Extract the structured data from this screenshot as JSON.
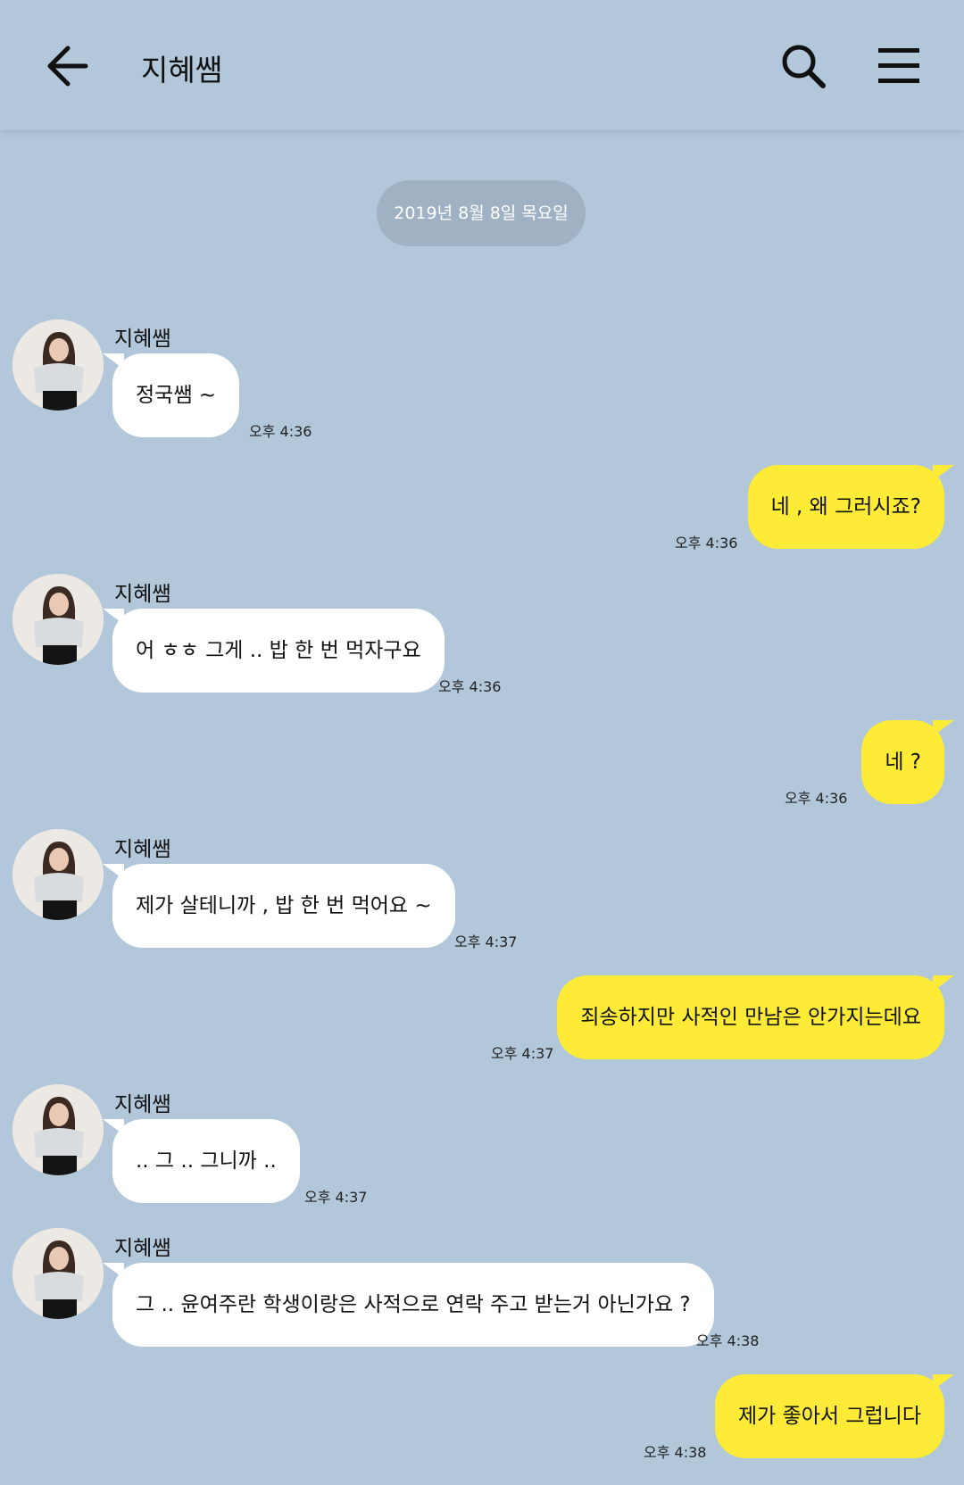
{
  "header": {
    "title": "지혜쌤",
    "icons": {
      "back": "arrow-left-icon",
      "search": "search-icon",
      "menu": "hamburger-menu-icon"
    }
  },
  "date_divider": "2019년 8월 8일 목요일",
  "colors": {
    "background": "#b2c7da",
    "outgoing_bubble": "#fdeb37",
    "incoming_bubble": "#ffffff",
    "date_pill": "#9fb1c3"
  },
  "messages": [
    {
      "sender": "지혜쌤",
      "text": "정국쌤 ~",
      "time": "오후 4:36"
    },
    {
      "text": "네 , 왜 그러시죠?",
      "time": "오후 4:36"
    },
    {
      "sender": "지혜쌤",
      "text": "어 ㅎㅎ 그게 .. 밥 한 번 먹자구요",
      "time": "오후 4:36"
    },
    {
      "text": "네 ?",
      "time": "오후 4:36"
    },
    {
      "sender": "지혜쌤",
      "text": "제가 살테니까 , 밥 한 번 먹어요 ~",
      "time": "오후 4:37"
    },
    {
      "text": "죄송하지만 사적인 만남은 안가지는데요",
      "time": "오후 4:37"
    },
    {
      "sender": "지혜쌤",
      "text": ".. 그 .. 그니까 ..",
      "time": "오후 4:37"
    },
    {
      "sender": "지혜쌤",
      "text": "그 .. 윤여주란 학생이랑은 사적으로 연락 주고 받는거 아닌가요 ?",
      "time": "오후 4:38"
    },
    {
      "text": "제가 좋아서 그럽니다",
      "time": "오후 4:38"
    }
  ]
}
